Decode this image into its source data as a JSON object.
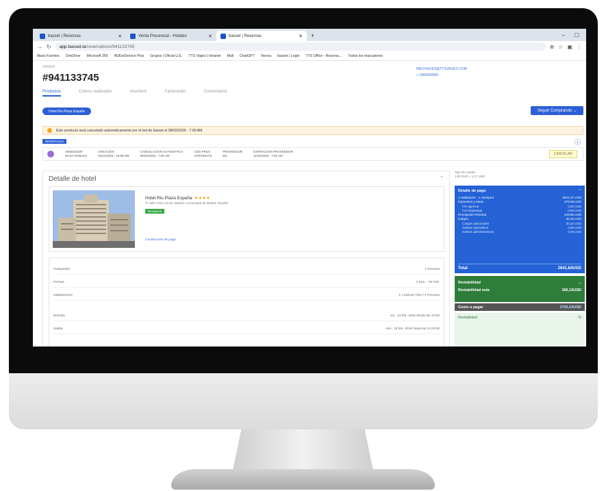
{
  "browser": {
    "tabs": [
      {
        "label": "basset | Reservas",
        "active": false
      },
      {
        "label": "Venta Presencial - Hoteles",
        "active": false
      },
      {
        "label": "basset | Reservas",
        "active": true
      }
    ],
    "url_host": "app.basset.la",
    "url_path": "/reservations/941133745",
    "bookmarks": [
      "Mass Fuentes",
      "OneDrive",
      "Microsoft 365",
      "ADExtService Plus",
      "Grupos | Oficial U.E.",
      "TTS Viajes | Intranet",
      "Mail",
      "ChatGPT",
      "Tereva",
      "basset | Login",
      "TTS Office - Reserva...",
      "Todos los marcadores"
    ]
  },
  "booking": {
    "label": "ORDEN",
    "id": "#941133745",
    "contact_email": "INFOVIAJES@TTSVIAJES.COM",
    "contact_phone": "+ 1800000000"
  },
  "subtabs": [
    "Productos",
    "Cobros realizados",
    "Vouchers",
    "Facturación",
    "Comentarios"
  ],
  "product_pill": "Hotel Riu Plaza España",
  "continue_button": "Seguir Comprando",
  "warning": "Este producto será cancelado automáticamente por el bot de basset el 08/02/2026 - 7:00 AM",
  "status_badge": "RESERVADA",
  "info_row": {
    "cells": [
      [
        "VENDEDOR",
        "MASA ROBLES"
      ],
      [
        "CREACIÓN",
        "04/11/2025 - 16:58 PM"
      ],
      [
        "CANCELACIÓN AUTOMÁTICA",
        "08/02/2026 - 7:00 AM"
      ],
      [
        "COD PROV.",
        "4700765ATS"
      ],
      [
        "PROVEEDOR",
        "BS"
      ],
      [
        "EXPIRACIÓN PROVEEDOR",
        "11/02/2026 - 7:00 AM"
      ]
    ],
    "cancel_button": "CANCELAR"
  },
  "hotel": {
    "section_title": "Detalle de hotel",
    "name": "Hotel Riu Plaza España",
    "stars": "★★★★",
    "address": "Calle Gran Vía 84, Madrid, Comunidad de Madrid, España",
    "tag": "Desayuno",
    "link": "Condiciones de pago"
  },
  "details_rows": [
    {
      "label": "Huéspedes",
      "value": "1 Persona"
    },
    {
      "label": "Fechas",
      "value": "1 Ene. - 26 Feb."
    },
    {
      "label": "Habitaciones",
      "value": "1 x Deluxe Twin / 1 Persona"
    },
    {
      "label": "Entrada",
      "value": "vie., 13 feb. 2026 desde las 14:00"
    },
    {
      "label": "Salida",
      "value": "mié., 18 feb. 2026 hasta las 11:00:00"
    }
  ],
  "side_meta": {
    "label": "Tipo de cambio",
    "value": "1,00 EUR = 1,17 USD"
  },
  "payment": {
    "title": "Detalle de pago",
    "lines": [
      {
        "label": "1 Habitación - 1 Huésped",
        "value": "2841,37 USD",
        "sub": false
      },
      {
        "label": "Impuestos y tasas",
        "value": "479,05 USD",
        "sub": false
      },
      {
        "label": "IVA agencia",
        "value": "0,00 USD",
        "sub": true
      },
      {
        "label": "IVA hospedaje",
        "value": "0,00 USD",
        "sub": true
      },
      {
        "label": "Percepción RG5463",
        "value": "449,85 USD",
        "sub": false
      },
      {
        "label": "Cargos",
        "value": "30,32 USD",
        "sub": false
      },
      {
        "label": "Cargos adicionales",
        "value": "30,32 USD",
        "sub": true
      },
      {
        "label": "Gastos Operativos",
        "value": "0,00 USD",
        "sub": true
      },
      {
        "label": "Gastos administrativos",
        "value": "0,00 USD",
        "sub": true
      }
    ],
    "total_label": "Total",
    "total_value": "2641,84USD"
  },
  "profit": {
    "label": "Rentabilidad",
    "net_label": "Rentabilidad neta",
    "net_value": "366,16USD"
  },
  "cost": {
    "label": "Costo a pagar",
    "value": "1791,53USD"
  },
  "profit2": {
    "label": "Rentabilidad",
    "value": "%"
  }
}
